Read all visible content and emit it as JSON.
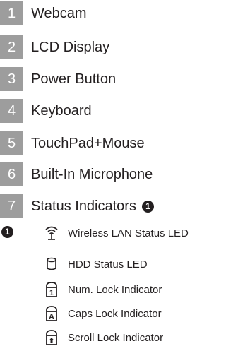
{
  "items": [
    {
      "number": "1",
      "label": "Webcam"
    },
    {
      "number": "2",
      "label": "LCD Display"
    },
    {
      "number": "3",
      "label": "Power Button"
    },
    {
      "number": "4",
      "label": "Keyboard"
    },
    {
      "number": "5",
      "label": "TouchPad+Mouse"
    },
    {
      "number": "6",
      "label": "Built-In Microphone"
    },
    {
      "number": "7",
      "label": "Status Indicators"
    }
  ],
  "note_marker": "❶",
  "indicators": [
    {
      "icon": "wireless-icon",
      "label": "Wireless LAN Status LED"
    },
    {
      "icon": "hdd-icon",
      "label": "HDD Status LED"
    },
    {
      "icon": "num-lock-icon",
      "label": "Num. Lock Indicator"
    },
    {
      "icon": "caps-lock-icon",
      "label": "Caps Lock Indicator"
    },
    {
      "icon": "scroll-lock-icon",
      "label": "Scroll Lock Indicator"
    }
  ],
  "colors": {
    "number_box": "#9d9d9d",
    "text": "#231f20",
    "background": "#ffffff"
  }
}
